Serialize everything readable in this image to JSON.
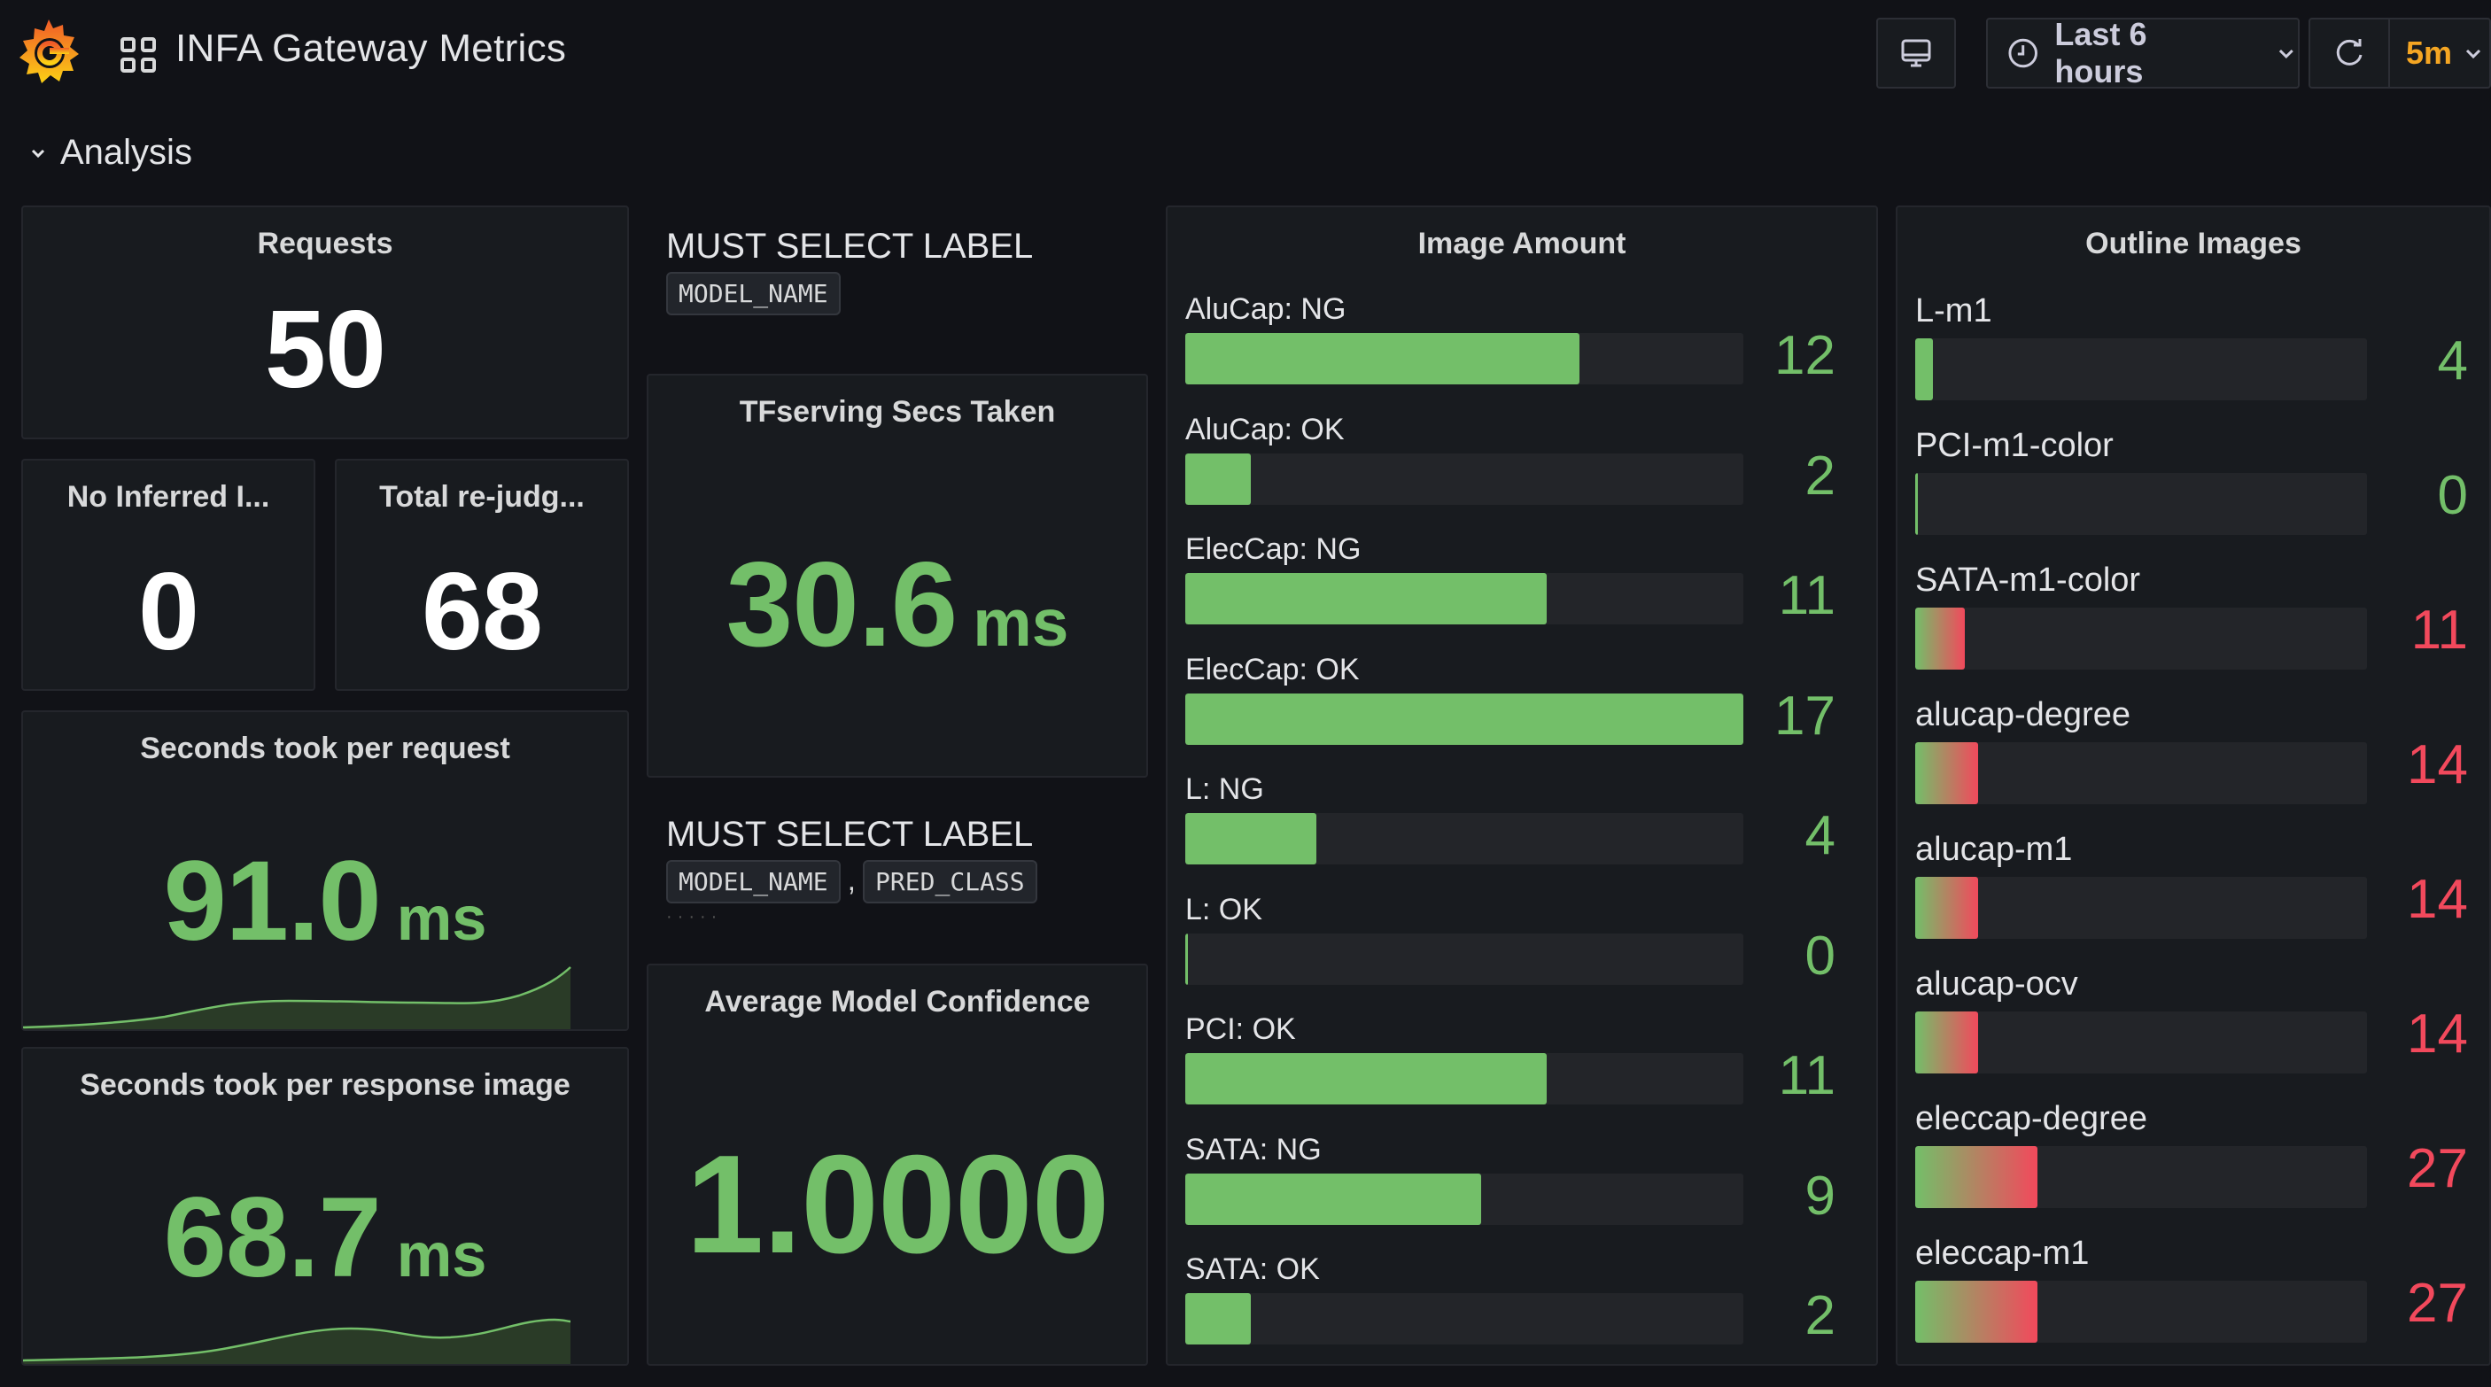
{
  "header": {
    "title": "INFA Gateway Metrics",
    "time_range": "Last 6 hours",
    "refresh_interval": "5m"
  },
  "row": {
    "title": "Analysis"
  },
  "colors": {
    "green": "#73bf69",
    "red": "#f2495c",
    "orange": "#f5a623",
    "bg": "#111217",
    "panel": "#181b1f"
  },
  "panels": {
    "requests": {
      "title": "Requests",
      "value": "50"
    },
    "no_inferred": {
      "title": "No Inferred I...",
      "value": "0"
    },
    "total_rejudge": {
      "title": "Total re-judg...",
      "value": "68"
    },
    "secs_per_request": {
      "title": "Seconds took per request",
      "value": "91.0",
      "unit": "ms"
    },
    "secs_per_image": {
      "title": "Seconds took per response image",
      "value": "68.7",
      "unit": "ms"
    },
    "must_select_1": {
      "title": "MUST SELECT LABEL",
      "labels": [
        "MODEL_NAME"
      ]
    },
    "tfserving": {
      "title": "TFserving Secs Taken",
      "value": "30.6",
      "unit": "ms"
    },
    "must_select_2": {
      "title": "MUST SELECT LABEL",
      "labels": [
        "MODEL_NAME",
        "PRED_CLASS"
      ],
      "separator": ","
    },
    "avg_confidence": {
      "title": "Average Model Confidence",
      "value": "1.0000"
    },
    "image_amount": {
      "title": "Image Amount",
      "max": 17,
      "items": [
        {
          "label": "AluCap: NG",
          "value": 12
        },
        {
          "label": "AluCap: OK",
          "value": 2
        },
        {
          "label": "ElecCap: NG",
          "value": 11
        },
        {
          "label": "ElecCap: OK",
          "value": 17
        },
        {
          "label": "L: NG",
          "value": 4
        },
        {
          "label": "L: OK",
          "value": 0
        },
        {
          "label": "PCI: OK",
          "value": 11
        },
        {
          "label": "SATA: NG",
          "value": 9
        },
        {
          "label": "SATA: OK",
          "value": 2
        }
      ]
    },
    "outline_images": {
      "title": "Outline Images",
      "max": 100,
      "items": [
        {
          "label": "L-m1",
          "value": 4,
          "status": "green"
        },
        {
          "label": "PCI-m1-color",
          "value": 0,
          "status": "green"
        },
        {
          "label": "SATA-m1-color",
          "value": 11,
          "status": "red"
        },
        {
          "label": "alucap-degree",
          "value": 14,
          "status": "red"
        },
        {
          "label": "alucap-m1",
          "value": 14,
          "status": "red"
        },
        {
          "label": "alucap-ocv",
          "value": 14,
          "status": "red"
        },
        {
          "label": "eleccap-degree",
          "value": 27,
          "status": "red"
        },
        {
          "label": "eleccap-m1",
          "value": 27,
          "status": "red"
        }
      ]
    }
  }
}
